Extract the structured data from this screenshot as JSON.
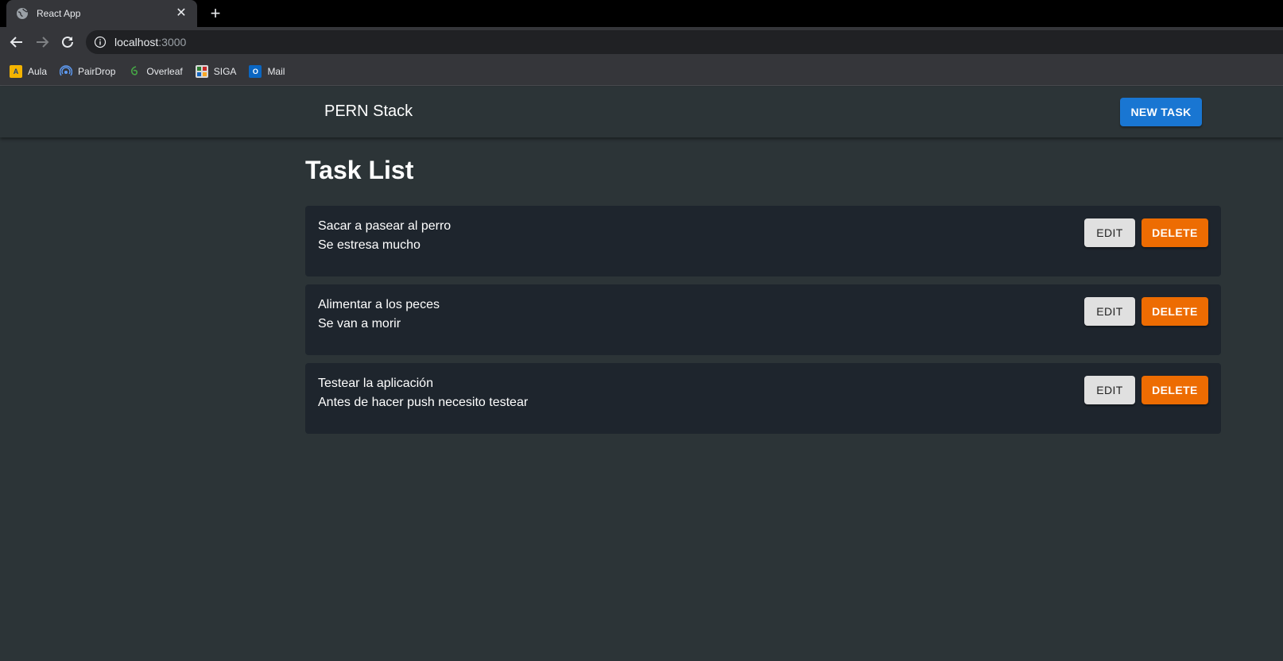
{
  "browser": {
    "tab_title": "React App",
    "url_host": "localhost",
    "url_port": ":3000",
    "bookmarks": [
      {
        "label": "Aula",
        "icon": "aula-icon"
      },
      {
        "label": "PairDrop",
        "icon": "pairdrop-icon"
      },
      {
        "label": "Overleaf",
        "icon": "overleaf-icon"
      },
      {
        "label": "SIGA",
        "icon": "siga-icon"
      },
      {
        "label": "Mail",
        "icon": "outlook-icon"
      }
    ]
  },
  "appbar": {
    "brand": "PERN Stack",
    "new_task_label": "NEW TASK"
  },
  "main": {
    "heading": "Task List",
    "edit_label": "EDIT",
    "delete_label": "DELETE",
    "tasks": [
      {
        "title": "Sacar a pasear al perro",
        "description": "Se estresa mucho"
      },
      {
        "title": "Alimentar a los peces",
        "description": "Se van a morir"
      },
      {
        "title": "Testear la aplicación",
        "description": "Antes de hacer push necesito testear"
      }
    ]
  },
  "colors": {
    "primary": "#1976d2",
    "warning": "#ed6c02",
    "background": "#2c3437",
    "card": "#1e252d"
  }
}
